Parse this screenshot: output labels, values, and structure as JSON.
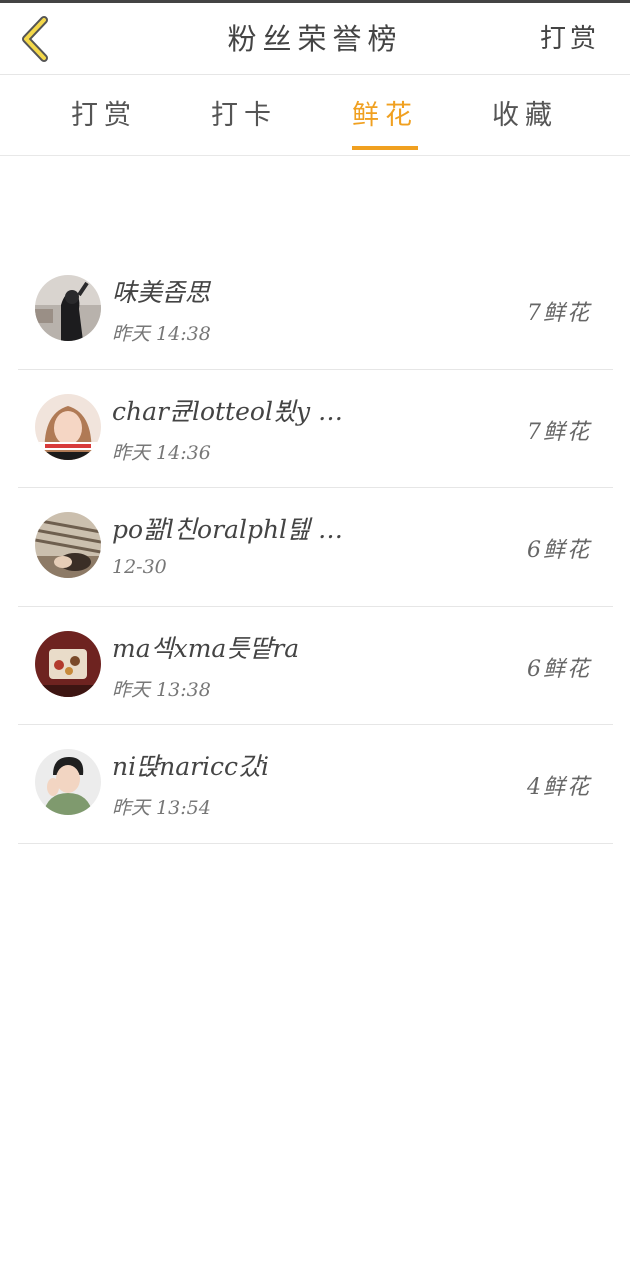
{
  "header": {
    "title": "粉丝荣誉榜",
    "right_action": "打赏",
    "back_icon": "chevron-left-icon",
    "accent_color": "#f0a020"
  },
  "tabs": [
    {
      "label": "打赏",
      "active": false
    },
    {
      "label": "打卡",
      "active": false
    },
    {
      "label": "鲜花",
      "active": true
    },
    {
      "label": "收藏",
      "active": false
    }
  ],
  "fans": [
    {
      "name": "味美좁思",
      "time": "昨天 14:38",
      "count": "7鲜花"
    },
    {
      "name": "char큔lotteol뵜y …",
      "time": "昨天 14:36",
      "count": "7鲜花"
    },
    {
      "name": "po꽒l친oralphl텚 …",
      "time": "12-30",
      "count": "6鲜花"
    },
    {
      "name": "ma섹xma틋떁ra",
      "time": "昨天 13:38",
      "count": "6鲜花"
    },
    {
      "name": "ni땭naricc갔i",
      "time": "昨天 13:54",
      "count": "4鲜花"
    }
  ]
}
